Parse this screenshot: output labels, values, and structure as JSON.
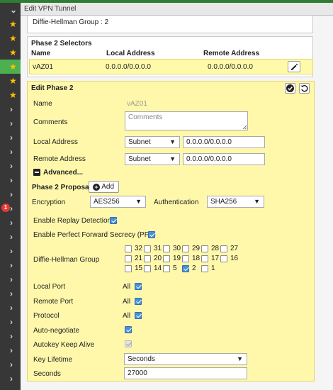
{
  "window": {
    "title": "Edit VPN Tunnel"
  },
  "sidebar": {
    "badge_count": "1"
  },
  "dh_top": {
    "text": "Diffie-Hellman Group : 2"
  },
  "phase2_selectors": {
    "title": "Phase 2 Selectors",
    "columns": [
      "Name",
      "Local Address",
      "Remote Address"
    ],
    "row": {
      "name": "vAZ01",
      "local": "0.0.0.0/0.0.0.0",
      "remote": "0.0.0.0/0.0.0.0"
    }
  },
  "edit_phase2": {
    "title": "Edit Phase 2",
    "name_label": "Name",
    "name_value": "vAZ01",
    "comments_label": "Comments",
    "comments_placeholder": "Comments",
    "local_address_label": "Local Address",
    "local_address_type": "Subnet",
    "local_address_value": "0.0.0.0/0.0.0.0",
    "remote_address_label": "Remote Address",
    "remote_address_type": "Subnet",
    "remote_address_value": "0.0.0.0/0.0.0.0",
    "advanced_label": "Advanced...",
    "proposal_label": "Phase 2 Proposal",
    "add_label": "Add",
    "encryption_label": "Encryption",
    "encryption_value": "AES256",
    "authentication_label": "Authentication",
    "authentication_value": "SHA256",
    "replay_label": "Enable Replay Detection",
    "replay_checked": true,
    "pfs_label": "Enable Perfect Forward Secrecy (PFS)",
    "pfs_checked": true,
    "dh_label": "Diffie-Hellman Group",
    "dh_groups": [
      [
        {
          "n": "32",
          "on": false
        },
        {
          "n": "31",
          "on": false
        },
        {
          "n": "30",
          "on": false
        },
        {
          "n": "29",
          "on": false
        },
        {
          "n": "28",
          "on": false
        },
        {
          "n": "27",
          "on": false
        }
      ],
      [
        {
          "n": "21",
          "on": false
        },
        {
          "n": "20",
          "on": false
        },
        {
          "n": "19",
          "on": false
        },
        {
          "n": "18",
          "on": false
        },
        {
          "n": "17",
          "on": false
        },
        {
          "n": "16",
          "on": false
        }
      ],
      [
        {
          "n": "15",
          "on": false
        },
        {
          "n": "14",
          "on": false
        },
        {
          "n": "5",
          "on": false
        },
        {
          "n": "2",
          "on": true
        },
        {
          "n": "1",
          "on": false
        }
      ]
    ],
    "local_port_label": "Local Port",
    "local_port_value": "All",
    "remote_port_label": "Remote Port",
    "remote_port_value": "All",
    "protocol_label": "Protocol",
    "protocol_value": "All",
    "autonegotiate_label": "Auto-negotiate",
    "autokeep_label": "Autokey Keep Alive",
    "key_lifetime_label": "Key Lifetime",
    "key_lifetime_value": "Seconds",
    "seconds_label": "Seconds",
    "seconds_value": "27000"
  }
}
